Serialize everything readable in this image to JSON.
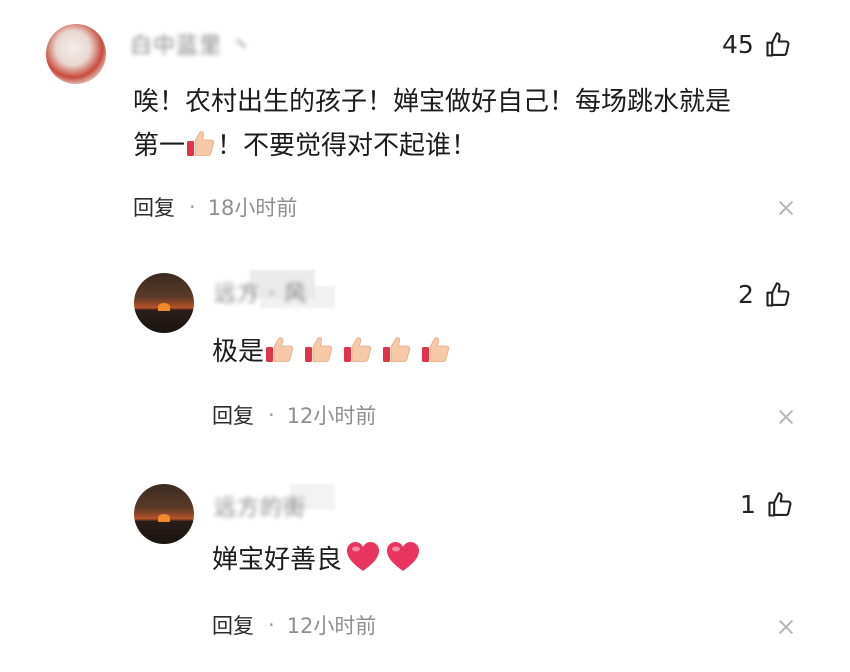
{
  "comments": [
    {
      "username": "白中蓝里 丶",
      "likes": "45",
      "text_line1": "唉！农村出生的孩子！婵宝做好自己！每场跳水就是",
      "text_line2_a": "第一",
      "text_line2_b": "！不要觉得对不起谁！",
      "reply_label": "回复",
      "dot": "·",
      "time": "18小时前"
    },
    {
      "username": "远方 · 风",
      "likes": "2",
      "text": "极是",
      "reply_label": "回复",
      "dot": "·",
      "time": "12小时前"
    },
    {
      "username": "远方的街",
      "likes": "1",
      "text": "婵宝好善良",
      "reply_label": "回复",
      "dot": "·",
      "time": "12小时前"
    }
  ],
  "icons": {
    "like": "thumbs-up-outline-icon",
    "close": "close-icon",
    "emoji_thumb": "thumbs-up-emoji-icon",
    "emoji_heart": "heart-emoji-icon"
  },
  "colors": {
    "text": "#1c1c1c",
    "meta": "#8f8f8f",
    "heart": "#e8345f",
    "thumb_skin": "#f6c9a8"
  }
}
